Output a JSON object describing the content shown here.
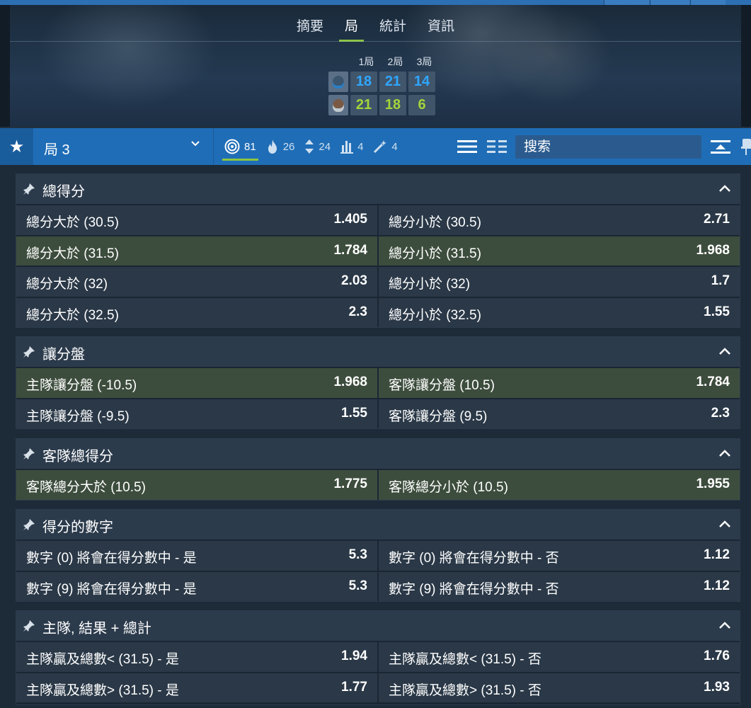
{
  "header": {
    "tabs": [
      {
        "label": "摘要",
        "active": false
      },
      {
        "label": "局",
        "active": true
      },
      {
        "label": "統計",
        "active": false
      },
      {
        "label": "資訊",
        "active": false
      }
    ],
    "score_columns": [
      "1局",
      "2局",
      "3局"
    ],
    "players": [
      {
        "scores": [
          "18",
          "21",
          "14"
        ],
        "color": "#2fa7ff"
      },
      {
        "scores": [
          "21",
          "18",
          "6"
        ],
        "color": "#a3d43a"
      }
    ]
  },
  "toolbar": {
    "period_label": "局 3",
    "filters": [
      {
        "icon": "target-icon",
        "count": "81",
        "active": true
      },
      {
        "icon": "flame-icon",
        "count": "26",
        "active": false
      },
      {
        "icon": "up-down-arrows-icon",
        "count": "24",
        "active": false
      },
      {
        "icon": "bar-stats-icon",
        "count": "4",
        "active": false
      },
      {
        "icon": "magic-wand-icon",
        "count": "4",
        "active": false
      }
    ],
    "search_placeholder": "搜索"
  },
  "sections": [
    {
      "title": "總得分",
      "rows": [
        [
          {
            "name": "總分大於 (30.5)",
            "odds": "1.405",
            "hl": false
          },
          {
            "name": "總分小於 (30.5)",
            "odds": "2.71",
            "hl": false
          }
        ],
        [
          {
            "name": "總分大於 (31.5)",
            "odds": "1.784",
            "hl": true
          },
          {
            "name": "總分小於 (31.5)",
            "odds": "1.968",
            "hl": true
          }
        ],
        [
          {
            "name": "總分大於 (32)",
            "odds": "2.03",
            "hl": false
          },
          {
            "name": "總分小於 (32)",
            "odds": "1.7",
            "hl": false
          }
        ],
        [
          {
            "name": "總分大於 (32.5)",
            "odds": "2.3",
            "hl": false
          },
          {
            "name": "總分小於 (32.5)",
            "odds": "1.55",
            "hl": false
          }
        ]
      ]
    },
    {
      "title": "讓分盤",
      "rows": [
        [
          {
            "name": "主隊讓分盤 (-10.5)",
            "odds": "1.968",
            "hl": true
          },
          {
            "name": "客隊讓分盤 (10.5)",
            "odds": "1.784",
            "hl": true
          }
        ],
        [
          {
            "name": "主隊讓分盤 (-9.5)",
            "odds": "1.55",
            "hl": false
          },
          {
            "name": "客隊讓分盤 (9.5)",
            "odds": "2.3",
            "hl": false
          }
        ]
      ]
    },
    {
      "title": "客隊總得分",
      "rows": [
        [
          {
            "name": "客隊總分大於 (10.5)",
            "odds": "1.775",
            "hl": true
          },
          {
            "name": "客隊總分小於 (10.5)",
            "odds": "1.955",
            "hl": true
          }
        ]
      ]
    },
    {
      "title": "得分的數字",
      "rows": [
        [
          {
            "name": "數字 (0) 將會在得分數中 - 是",
            "odds": "5.3",
            "hl": false
          },
          {
            "name": "數字 (0) 將會在得分數中 - 否",
            "odds": "1.12",
            "hl": false
          }
        ],
        [
          {
            "name": "數字 (9) 將會在得分數中 - 是",
            "odds": "5.3",
            "hl": false
          },
          {
            "name": "數字 (9) 將會在得分數中 - 否",
            "odds": "1.12",
            "hl": false
          }
        ]
      ]
    },
    {
      "title": "主隊, 結果 + 總計",
      "rows": [
        [
          {
            "name": "主隊贏及總數< (31.5) - 是",
            "odds": "1.94",
            "hl": false
          },
          {
            "name": "主隊贏及總數< (31.5) - 否",
            "odds": "1.76",
            "hl": false
          }
        ],
        [
          {
            "name": "主隊贏及總數> (31.5) - 是",
            "odds": "1.77",
            "hl": false
          },
          {
            "name": "主隊贏及總數> (31.5) - 否",
            "odds": "1.93",
            "hl": false
          }
        ]
      ]
    }
  ],
  "colors": {
    "accent_green": "#8dc63f",
    "toolbar_blue": "#1f6db6",
    "highlight_row": "#3d4d3d"
  }
}
